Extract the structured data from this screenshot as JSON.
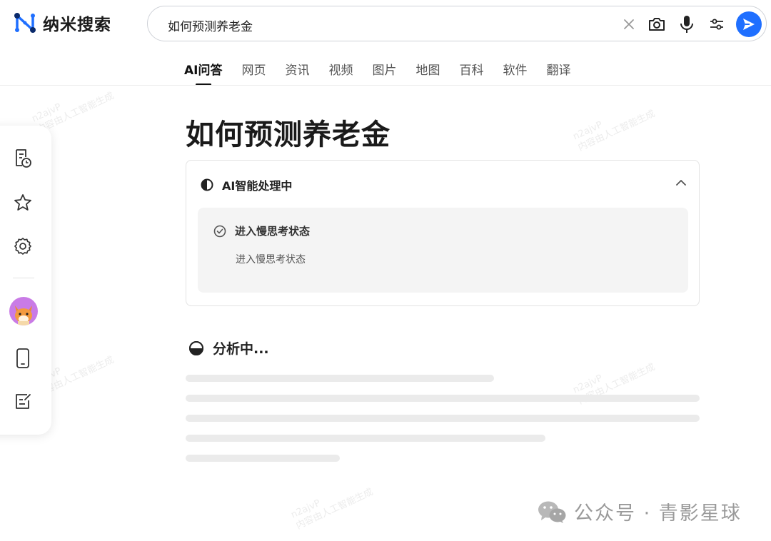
{
  "brand": {
    "name": "纳米搜索"
  },
  "search": {
    "value": "如何预测养老金"
  },
  "tabs": [
    {
      "label": "AI问答",
      "active": true
    },
    {
      "label": "网页"
    },
    {
      "label": "资讯"
    },
    {
      "label": "视频"
    },
    {
      "label": "图片"
    },
    {
      "label": "地图"
    },
    {
      "label": "百科"
    },
    {
      "label": "软件"
    },
    {
      "label": "翻译"
    }
  ],
  "sidebar": {
    "items": [
      {
        "icon": "history-document-icon"
      },
      {
        "icon": "star-icon"
      },
      {
        "icon": "gear-icon"
      },
      {
        "icon": "avatar"
      },
      {
        "icon": "phone-icon"
      },
      {
        "icon": "edit-note-icon"
      }
    ]
  },
  "main": {
    "title": "如何预测养老金",
    "ai_panel": {
      "status_label": "AI智能处理中",
      "step_title": "进入慢思考状态",
      "step_detail": "进入慢思考状态"
    },
    "analyzing_label": "分析中..."
  },
  "watermark": {
    "line1": "n2ajvP",
    "line2": "内容由人工智能生成"
  },
  "footer": {
    "text": "公众号 · 青影星球"
  },
  "colors": {
    "accent": "#1f6fff",
    "skeleton": "#ebebeb",
    "panel": "#f4f4f4"
  }
}
